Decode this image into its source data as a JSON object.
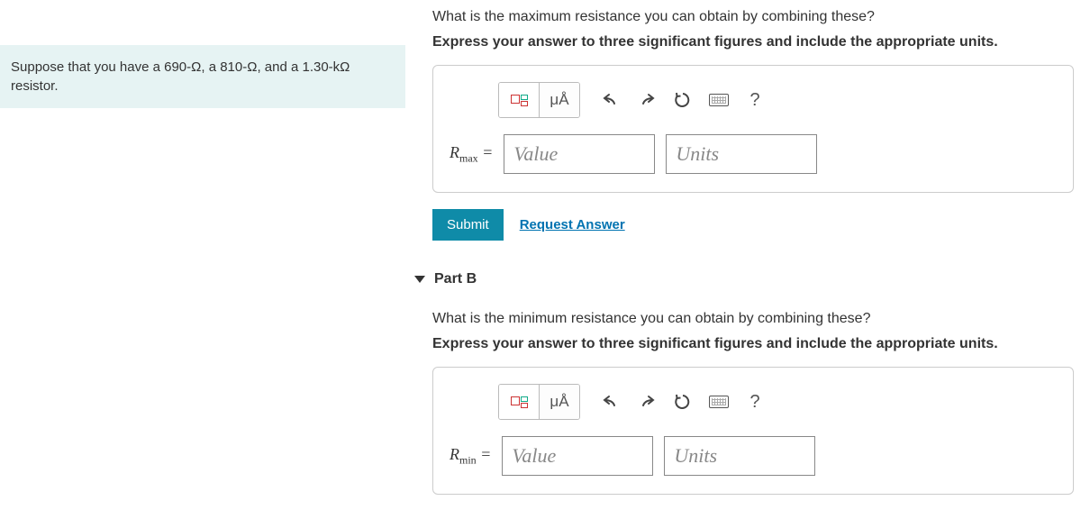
{
  "context": "Suppose that you have a 690-Ω, a 810-Ω, and a 1.30-kΩ resistor.",
  "partA": {
    "question": "What is the maximum resistance you can obtain by combining these?",
    "instruction": "Express your answer to three significant figures and include the appropriate units.",
    "var_prefix": "R",
    "var_sub": "max",
    "value_placeholder": "Value",
    "units_placeholder": "Units"
  },
  "partB": {
    "title": "Part B",
    "question": "What is the minimum resistance you can obtain by combining these?",
    "instruction": "Express your answer to three significant figures and include the appropriate units.",
    "var_prefix": "R",
    "var_sub": "min",
    "value_placeholder": "Value",
    "units_placeholder": "Units"
  },
  "toolbar": {
    "mu_label": "μÅ",
    "help_label": "?"
  },
  "buttons": {
    "submit": "Submit",
    "request_answer": "Request Answer"
  }
}
